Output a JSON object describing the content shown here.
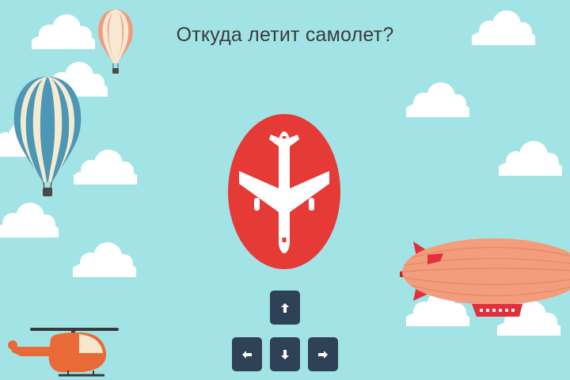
{
  "question": "Откуда летит самолет?",
  "center_icon": "airplane-icon",
  "arrow_keys": [
    {
      "name": "arrow-up-key",
      "icon": "arrow-up-icon"
    },
    {
      "name": "arrow-left-key",
      "icon": "arrow-left-icon"
    },
    {
      "name": "arrow-down-key",
      "icon": "arrow-down-icon"
    },
    {
      "name": "arrow-right-key",
      "icon": "arrow-right-icon"
    }
  ],
  "colors": {
    "sky": "#a2e4e6",
    "circle": "#e53a35",
    "key": "#2f4156",
    "text": "#3b3b3b"
  }
}
